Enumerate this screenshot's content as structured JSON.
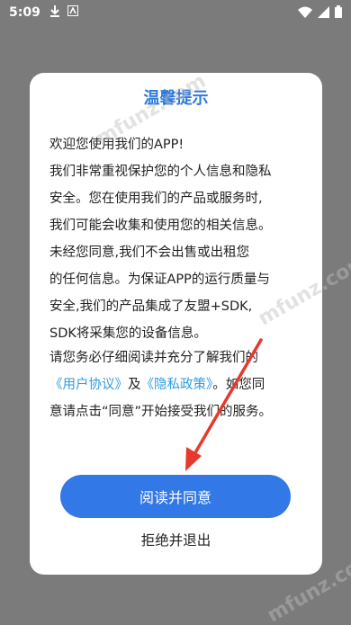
{
  "status_bar": {
    "time": "5:09"
  },
  "dialog": {
    "title": "温馨提示",
    "body_lines": [
      "欢迎您使用我们的APP!",
      "我们非常重视保护您的个人信息和隐私",
      "安全。您在使用我们的产品或服务时,",
      "我们可能会收集和使用您的相关信息。",
      "未经您同意,我们不会出售或出租您",
      "的任何信息。为保证APP的运行质量与",
      "安全,我们的产品集成了友盟+SDK,",
      "SDK将采集您的设备信息。"
    ],
    "notice": {
      "line1": "请您务必仔细阅读并充分了解我们的",
      "user_agreement": "《用户协议》",
      "conjunction": "及",
      "privacy_policy": "《隐私政策》",
      "after_links": "。如您同",
      "line3": "意请点击“同意”开始接受我们的服务。"
    },
    "agree_label": "阅读并同意",
    "reject_label": "拒绝并退出"
  },
  "watermark": "mfunz.com",
  "colors": {
    "accent": "#3278e6",
    "title": "#2f7ad9",
    "link": "#2f9be0",
    "arrow": "#e53a2b",
    "overlay": "#7b7b7b"
  }
}
